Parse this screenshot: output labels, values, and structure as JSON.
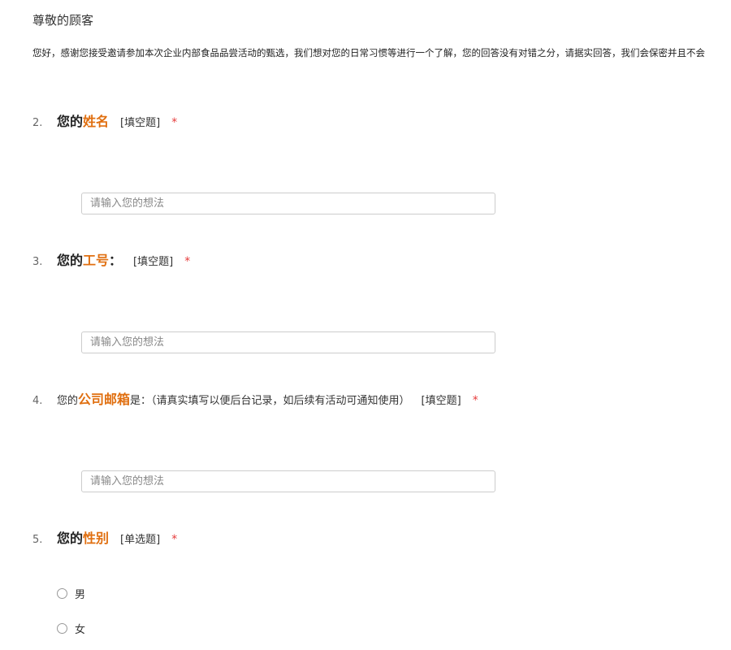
{
  "survey": {
    "greeting": "尊敬的顾客",
    "intro": "您好，感谢您接受邀请参加本次企业内部食品品尝活动的甄选，我们想对您的日常习惯等进行一个了解，您的回答没有对错之分，请据实回答，我们会保密并且不会"
  },
  "questions": [
    {
      "num": "2.",
      "pre": "您的",
      "highlight": "姓名",
      "post": "",
      "type": "[填空题]",
      "required": "*",
      "placeholder": "请输入您的想法"
    },
    {
      "num": "3.",
      "pre": "您的",
      "highlight": "工号",
      "post": "：",
      "type": "[填空题]",
      "required": "*",
      "placeholder": "请输入您的想法"
    },
    {
      "num": "4.",
      "pre": "您的",
      "highlight": "公司邮箱",
      "post": "是：（请真实填写以便后台记录，如后续有活动可通知使用）",
      "type": "[填空题]",
      "required": "*",
      "placeholder": "请输入您的想法"
    },
    {
      "num": "5.",
      "pre": "您的",
      "highlight": "性别",
      "post": "",
      "type": "[单选题]",
      "required": "*",
      "options": [
        "男",
        "女"
      ]
    }
  ],
  "colors": {
    "highlight": "#e06f10",
    "required": "#e63b3b",
    "input_border": "#cccccc"
  },
  "icons": {
    "radio": "radio-unchecked-icon"
  }
}
